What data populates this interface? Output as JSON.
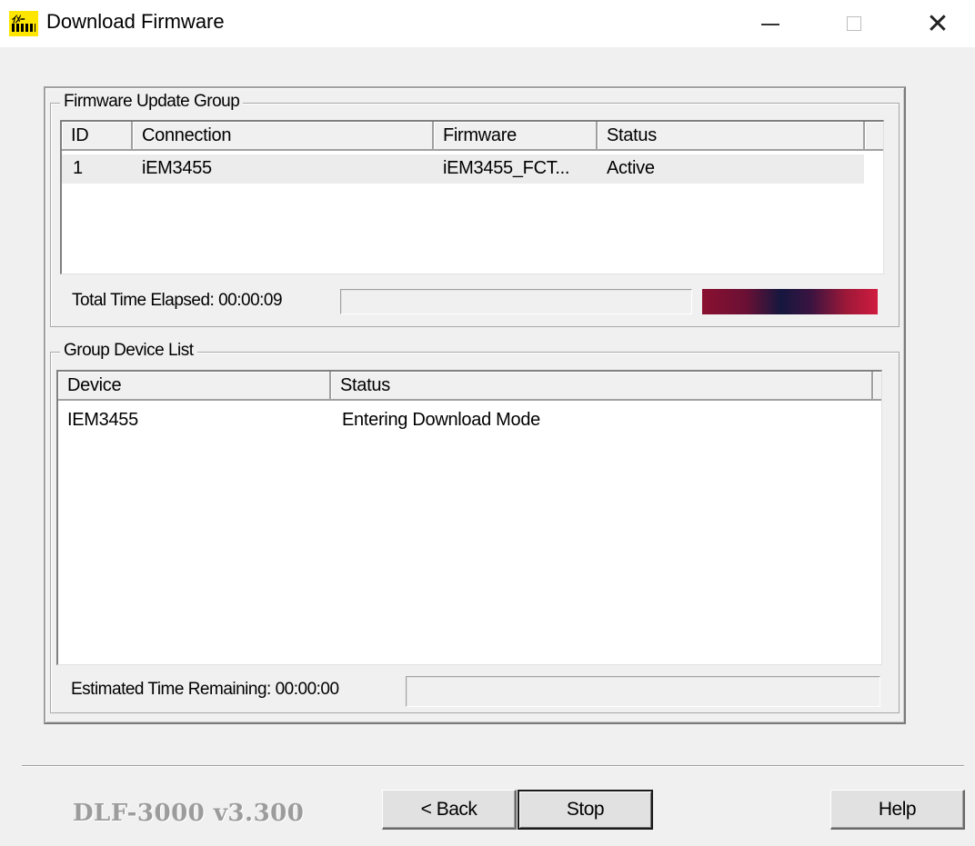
{
  "window": {
    "title": "Download Firmware",
    "minimize_glyph": "—",
    "maximize_glyph": "☐",
    "close_glyph": "✕"
  },
  "app_icon": {
    "name": "dlf-app-icon",
    "text": "ｲﾒｰ"
  },
  "firmware_group": {
    "label": "Firmware Update Group",
    "columns": [
      "ID",
      "Connection",
      "Firmware",
      "Status"
    ],
    "rows": [
      {
        "id": "1",
        "connection": "iEM3455",
        "firmware": "iEM3455_FCT...",
        "status": "Active"
      }
    ],
    "total_time_label": "Total Time Elapsed: 00:00:09"
  },
  "device_group": {
    "label": "Group Device List",
    "columns": [
      "Device",
      "Status"
    ],
    "rows": [
      {
        "device": "IEM3455",
        "status": "Entering Download Mode"
      }
    ],
    "remaining_label": "Estimated Time Remaining: 00:00:00"
  },
  "footer": {
    "version": "DLF-3000 v3.300",
    "back_label": "< Back",
    "stop_label": "Stop",
    "help_label": "Help"
  },
  "colors": {
    "marquee_start": "#8a1030",
    "marquee_mid": "#15173f",
    "marquee_end": "#d01c40"
  }
}
